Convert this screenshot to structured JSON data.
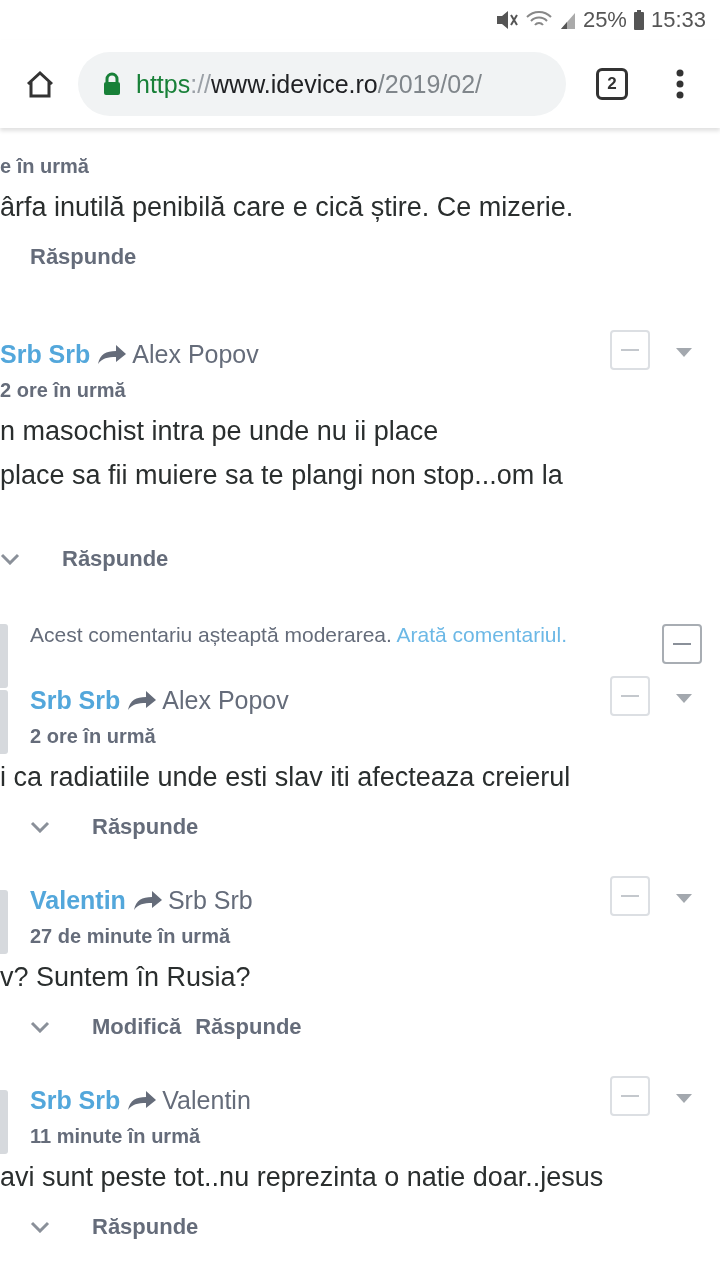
{
  "status_bar": {
    "battery": "25%",
    "time": "15:33"
  },
  "browser": {
    "url": [
      {
        "text": "https",
        "kind": "scheme"
      },
      {
        "text": "://",
        "kind": "separator"
      },
      {
        "text": "www.idevice.ro",
        "kind": "host"
      },
      {
        "text": "/2019/02/",
        "kind": "path"
      }
    ],
    "tab_count": "2"
  },
  "comments": [
    {
      "kind": "cut",
      "time": "e în urmă",
      "body": [
        "ârfa inutilă penibilă care e cică știre. Ce mizerie."
      ],
      "collapse_toggle": false,
      "actions": [
        "Răspunde"
      ]
    },
    {
      "kind": "top",
      "author": "Srb Srb",
      "reply_to": "Alex Popov",
      "time": "2 ore în urmă",
      "body": [
        "n masochist intra pe unde nu ii place",
        "place sa fii muiere sa te plangi non stop...om la"
      ],
      "collapse_toggle": true,
      "actions": [
        "Răspunde"
      ]
    },
    {
      "kind": "moderation",
      "text": "Acest comentariu așteaptă moderarea.",
      "link": "Arată comentariul."
    },
    {
      "kind": "nested",
      "author": "Srb Srb",
      "reply_to": "Alex Popov",
      "time": "2 ore în urmă",
      "body": [
        "i ca radiatiile unde esti slav iti afecteaza creierul"
      ],
      "collapse_toggle": true,
      "actions": [
        "Răspunde"
      ]
    },
    {
      "kind": "nested",
      "author": "Valentin",
      "reply_to": "Srb Srb",
      "time": "27 de minute în urmă",
      "body": [
        "v? Suntem în Rusia?"
      ],
      "collapse_toggle": true,
      "actions": [
        "Modifică",
        "Răspunde"
      ]
    },
    {
      "kind": "nested",
      "author": "Srb Srb",
      "reply_to": "Valentin",
      "time": "11 minute în urmă",
      "body": [
        "avi sunt peste tot..nu reprezinta o natie doar..jesus"
      ],
      "collapse_toggle": true,
      "actions": [
        "Răspunde"
      ]
    }
  ]
}
